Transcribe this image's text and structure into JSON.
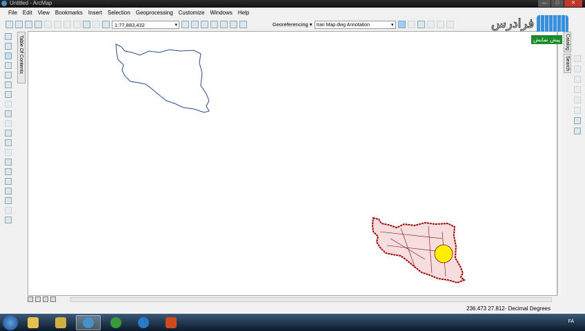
{
  "window": {
    "title": "Untitled - ArcMap"
  },
  "menu": [
    "File",
    "Edit",
    "View",
    "Bookmarks",
    "Insert",
    "Selection",
    "Geoprocessing",
    "Customize",
    "Windows",
    "Help"
  ],
  "toolbar": {
    "scale": "1:77,883,432",
    "georeferencing_label": "Georeferencing",
    "georef_layer": "Iran Map.dwg Annotation"
  },
  "toc_tab": "Table Of Contents",
  "right_tabs": [
    "Catalog",
    "Search"
  ],
  "status": {
    "coordinates": "236.473  27.812- Decimal Degrees"
  },
  "taskbar": {
    "language": "FA"
  },
  "watermark": {
    "name": "فرادرس",
    "badge": "پیش نمایش"
  },
  "colors": {
    "outline_layer": "#2a4a8a",
    "cad_layer": "#a00000",
    "highlight": "#ffee00"
  }
}
